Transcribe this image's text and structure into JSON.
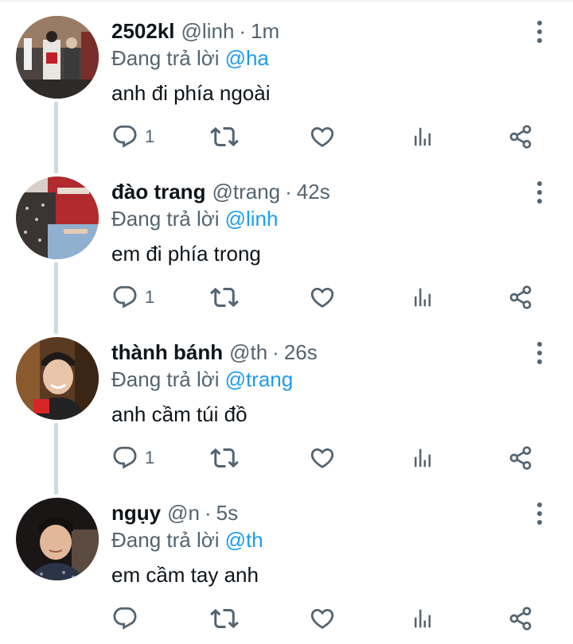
{
  "tweets": [
    {
      "name": "2502kl",
      "handle": "@linh",
      "separator": "·",
      "time": "1m",
      "reply_prefix": "Đang trả lời",
      "reply_to": "@ha",
      "text": "anh đi phía ngoài",
      "reply_count": "1",
      "avatar": "street-photo"
    },
    {
      "name": "đào trang",
      "handle": "@trang",
      "separator": "·",
      "time": "42s",
      "reply_prefix": "Đang trả lời",
      "reply_to": "@linh",
      "text": "em đi phía trong",
      "reply_count": "1",
      "avatar": "red-bag-photo"
    },
    {
      "name": "thành bánh",
      "handle": "@th",
      "separator": "·",
      "time": "26s",
      "reply_prefix": "Đang trả lời",
      "reply_to": "@trang",
      "text": "anh cầm túi đồ",
      "reply_count": "1",
      "avatar": "smiling-man-photo"
    },
    {
      "name": "ngụy",
      "handle": "@n",
      "separator": "·",
      "time": "5s",
      "reply_prefix": "Đang trả lời",
      "reply_to": "@th",
      "text": "em cầm tay anh",
      "reply_count": "",
      "avatar": "selfie-man-photo"
    }
  ],
  "icons": {
    "reply": "comment-icon",
    "retweet": "retweet-icon",
    "like": "heart-icon",
    "views": "analytics-icon",
    "share": "share-icon",
    "more": "more-vertical-icon"
  },
  "colors": {
    "text": "#0f1419",
    "secondary": "#536471",
    "link": "#1d9bf0",
    "thread_line": "#cfd9de"
  }
}
